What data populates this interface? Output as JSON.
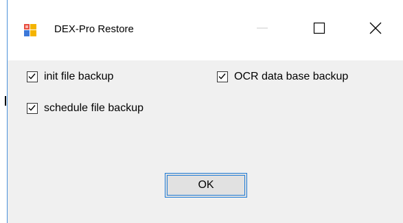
{
  "window": {
    "title": "DEX-Pro Restore",
    "icon": "app-window-icon",
    "controls": {
      "minimize_icon": "minimize-icon",
      "maximize_icon": "maximize-icon",
      "close_icon": "close-icon"
    }
  },
  "options": [
    {
      "label": "init file backup",
      "checked": true
    },
    {
      "label": "OCR data base backup",
      "checked": true
    },
    {
      "label": "schedule file backup",
      "checked": true
    }
  ],
  "ok_button": {
    "label": "OK"
  },
  "colors": {
    "accent": "#1e7bd6",
    "window_border": "#4a90d9",
    "client_bg": "#f0f0f0"
  }
}
